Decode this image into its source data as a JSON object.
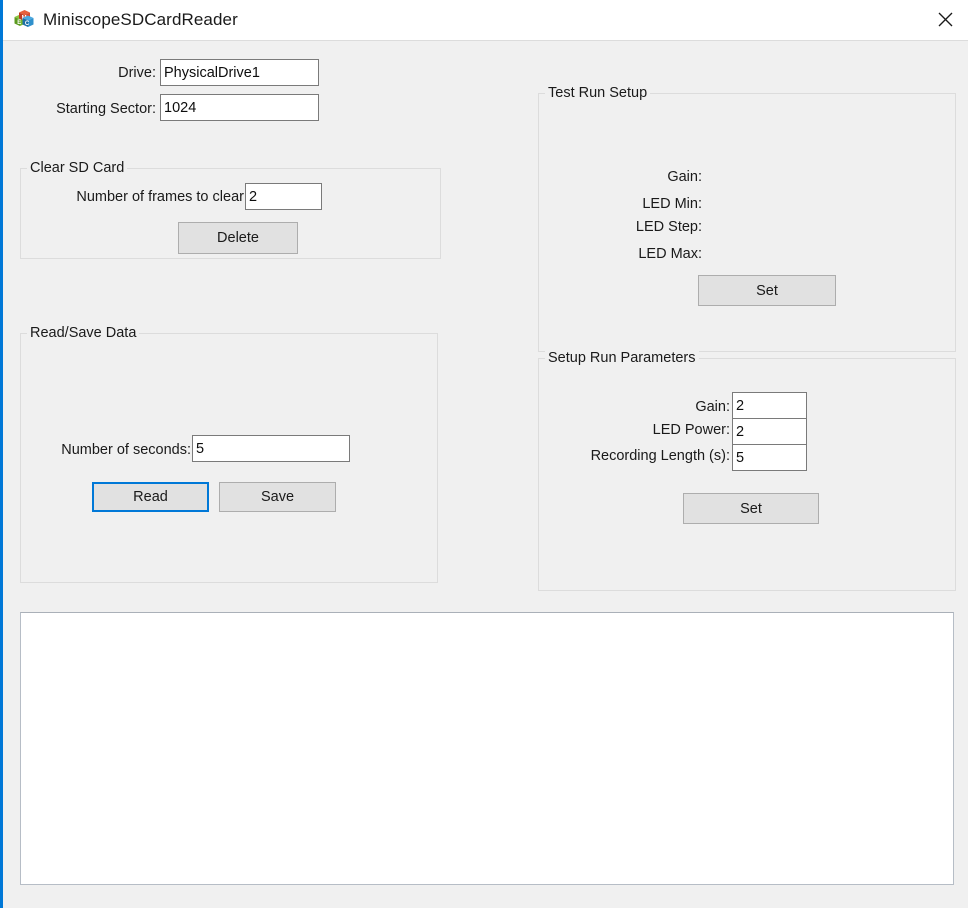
{
  "window": {
    "title": "MiniscopeSDCardReader",
    "icon": "app-cubes-icon",
    "close_label": "Close",
    "accent_color": "#0078d7",
    "background_color": "#f0f0f0"
  },
  "top_fields": {
    "drive": {
      "label": "Drive:",
      "value": "PhysicalDrive1"
    },
    "starting_sector": {
      "label": "Starting Sector:",
      "value": "1024"
    }
  },
  "clear_sd_card": {
    "title": "Clear SD Card",
    "frames_label": "Number of frames to clear:",
    "frames_value": "2",
    "delete_button": "Delete"
  },
  "read_save_data": {
    "title": "Read/Save Data",
    "seconds_label": "Number of seconds:",
    "seconds_value": "5",
    "read_button": "Read",
    "save_button": "Save"
  },
  "test_run_setup": {
    "title": "Test Run Setup",
    "gain_label": "Gain:",
    "gain_value": "",
    "led_min_label": "LED Min:",
    "led_min_value": "",
    "led_step_label": "LED Step:",
    "led_step_value": "",
    "led_max_label": "LED Max:",
    "led_max_value": "",
    "set_button": "Set"
  },
  "setup_run_parameters": {
    "title": "Setup Run Parameters",
    "gain_label": "Gain:",
    "gain_value": "2",
    "led_power_label": "LED Power:",
    "led_power_value": "2",
    "recording_length_label": "Recording Length (s):",
    "recording_length_value": "5",
    "set_button": "Set"
  },
  "output_log": {
    "value": ""
  }
}
